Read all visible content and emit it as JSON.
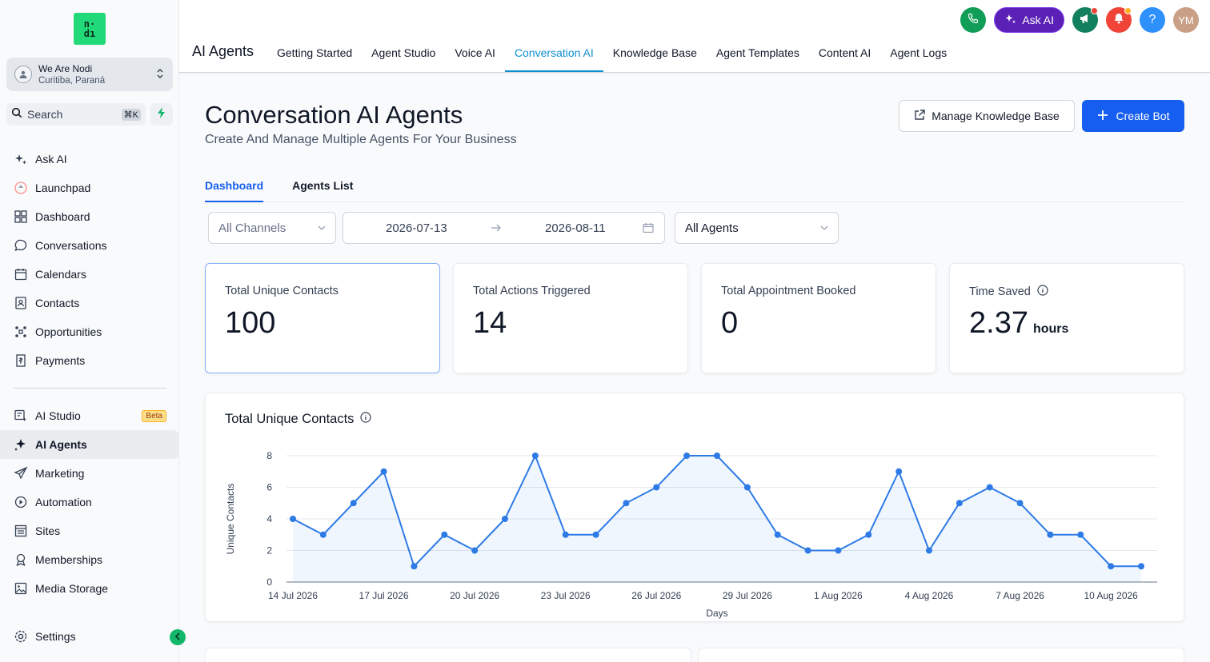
{
  "sidebar": {
    "logo_line1": "n·",
    "logo_line2": "dı",
    "account_name": "We Are Nodi",
    "account_location": "Curitiba, Paraná",
    "search_label": "Search",
    "search_shortcut": "⌘K",
    "items": [
      {
        "label": "Ask AI",
        "icon": "sparkles-icon"
      },
      {
        "label": "Launchpad",
        "icon": "launchpad-icon"
      },
      {
        "label": "Dashboard",
        "icon": "dashboard-icon"
      },
      {
        "label": "Conversations",
        "icon": "chat-icon"
      },
      {
        "label": "Calendars",
        "icon": "calendar-icon"
      },
      {
        "label": "Contacts",
        "icon": "contacts-icon"
      },
      {
        "label": "Opportunities",
        "icon": "opportunities-icon"
      },
      {
        "label": "Payments",
        "icon": "payments-icon"
      }
    ],
    "items2": [
      {
        "label": "AI Studio",
        "icon": "ai-studio-icon",
        "badge": "Beta"
      },
      {
        "label": "AI Agents",
        "icon": "ai-agents-icon"
      },
      {
        "label": "Marketing",
        "icon": "send-icon"
      },
      {
        "label": "Automation",
        "icon": "automation-icon"
      },
      {
        "label": "Sites",
        "icon": "sites-icon"
      },
      {
        "label": "Memberships",
        "icon": "memberships-icon"
      },
      {
        "label": "Media Storage",
        "icon": "image-icon"
      }
    ],
    "settings_label": "Settings"
  },
  "topbar": {
    "app_title": "AI Agents",
    "tabs": [
      "Getting Started",
      "Agent Studio",
      "Voice AI",
      "Conversation AI",
      "Knowledge Base",
      "Agent Templates",
      "Content AI",
      "Agent Logs"
    ],
    "active_tab": "Conversation AI",
    "ask_ai_label": "Ask AI",
    "avatar_initials": "YM",
    "help_glyph": "?"
  },
  "page": {
    "title": "Conversation AI Agents",
    "subtitle": "Create And Manage Multiple Agents For Your Business",
    "manage_kb_label": "Manage Knowledge Base",
    "create_bot_label": "Create Bot",
    "subtabs": [
      "Dashboard",
      "Agents List"
    ],
    "active_subtab": "Dashboard"
  },
  "filters": {
    "channels": "All Channels",
    "date_start": "2026-07-13",
    "date_end": "2026-08-11",
    "agents": "All Agents"
  },
  "stats": [
    {
      "label": "Total Unique Contacts",
      "value": "100",
      "unit": ""
    },
    {
      "label": "Total Actions Triggered",
      "value": "14",
      "unit": ""
    },
    {
      "label": "Total Appointment Booked",
      "value": "0",
      "unit": ""
    },
    {
      "label": "Time Saved",
      "value": "2.37",
      "unit": "hours"
    }
  ],
  "colors": {
    "accent": "#155eef",
    "tab_active": "#0e8fd1",
    "line": "#2e7be6",
    "phone": "#0f9d58",
    "ask_ai": "#5b21b6",
    "megaphone": "#12805c",
    "bell": "#f04438",
    "help": "#2e90fa"
  },
  "chart_data": {
    "type": "area",
    "title": "Total Unique Contacts",
    "xlabel": "Days",
    "ylabel": "Unique Contacts",
    "ylim": [
      0,
      8
    ],
    "yticks": [
      0,
      2,
      4,
      6,
      8
    ],
    "grid": true,
    "x": [
      "14 Jul 2026",
      "15 Jul 2026",
      "16 Jul 2026",
      "17 Jul 2026",
      "18 Jul 2026",
      "19 Jul 2026",
      "20 Jul 2026",
      "21 Jul 2026",
      "22 Jul 2026",
      "23 Jul 2026",
      "24 Jul 2026",
      "25 Jul 2026",
      "26 Jul 2026",
      "27 Jul 2026",
      "28 Jul 2026",
      "29 Jul 2026",
      "30 Jul 2026",
      "31 Jul 2026",
      "1 Aug 2026",
      "2 Aug 2026",
      "3 Aug 2026",
      "4 Aug 2026",
      "5 Aug 2026",
      "6 Aug 2026",
      "7 Aug 2026",
      "8 Aug 2026",
      "9 Aug 2026",
      "10 Aug 2026",
      "11 Aug 2026"
    ],
    "xtick_labels": [
      "14 Jul 2026",
      "17 Jul 2026",
      "20 Jul 2026",
      "23 Jul 2026",
      "26 Jul 2026",
      "29 Jul 2026",
      "1 Aug 2026",
      "4 Aug 2026",
      "7 Aug 2026",
      "10 Aug 2026"
    ],
    "series": [
      {
        "values": [
          4,
          3,
          5,
          7,
          1,
          3,
          2,
          4,
          8,
          3,
          3,
          5,
          6,
          8,
          8,
          6,
          3,
          2,
          2,
          3,
          7,
          2,
          5,
          6,
          5,
          3,
          3,
          1,
          1
        ]
      }
    ]
  }
}
